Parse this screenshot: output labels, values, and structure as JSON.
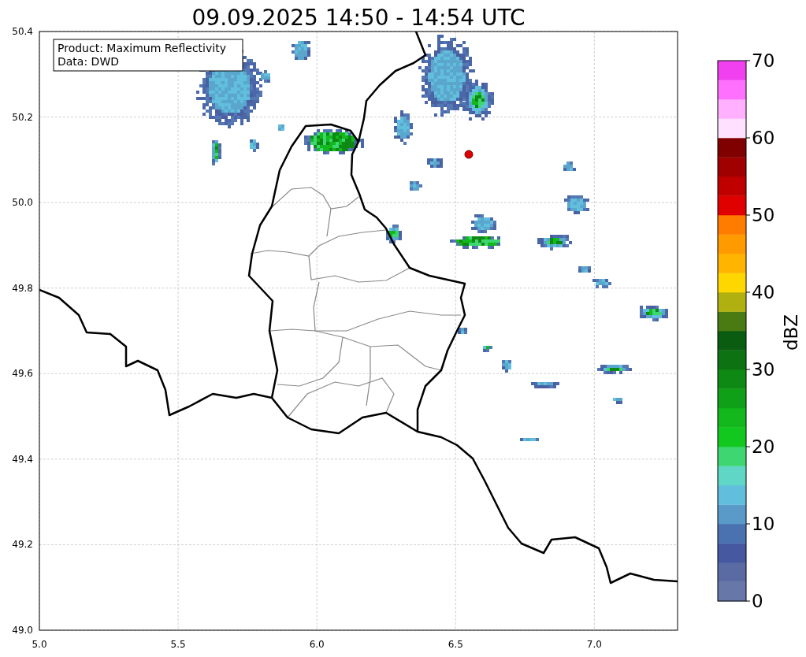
{
  "title": "09.09.2025 14:50 - 14:54 UTC",
  "legend": {
    "lines": [
      "Product: Maximum Reflectivity",
      "Data: DWD"
    ]
  },
  "map": {
    "xticks": [
      "5.0",
      "5.5",
      "6.0",
      "6.5",
      "7.0"
    ],
    "yticks": [
      "50.4",
      "50.2",
      "50.0",
      "49.8",
      "49.6",
      "49.4",
      "49.2",
      "49.0"
    ]
  },
  "colorbar": {
    "label": "dBZ",
    "ticks": [
      "70",
      "60",
      "50",
      "40",
      "30",
      "20",
      "10",
      "0"
    ],
    "segments": [
      {
        "color": "#6677a8"
      },
      {
        "color": "#5a6aa3"
      },
      {
        "color": "#4658a0"
      },
      {
        "color": "#4a72b0"
      },
      {
        "color": "#5a9ac8"
      },
      {
        "color": "#62bedd"
      },
      {
        "color": "#5fd6c6"
      },
      {
        "color": "#3dd670"
      },
      {
        "color": "#12c81e"
      },
      {
        "color": "#12b81c"
      },
      {
        "color": "#10a018"
      },
      {
        "color": "#0e8a14"
      },
      {
        "color": "#0c7212"
      },
      {
        "color": "#0a5c10"
      },
      {
        "color": "#4a7a12"
      },
      {
        "color": "#b0b010"
      },
      {
        "color": "#ffd700"
      },
      {
        "color": "#ffb400"
      },
      {
        "color": "#ff9a00"
      },
      {
        "color": "#ff7c00"
      },
      {
        "color": "#e00000"
      },
      {
        "color": "#c00000"
      },
      {
        "color": "#a00000"
      },
      {
        "color": "#800000"
      },
      {
        "color": "#ffe0ff"
      },
      {
        "color": "#ffb0ff"
      },
      {
        "color": "#ff70ff"
      },
      {
        "color": "#f040f0"
      }
    ]
  }
}
